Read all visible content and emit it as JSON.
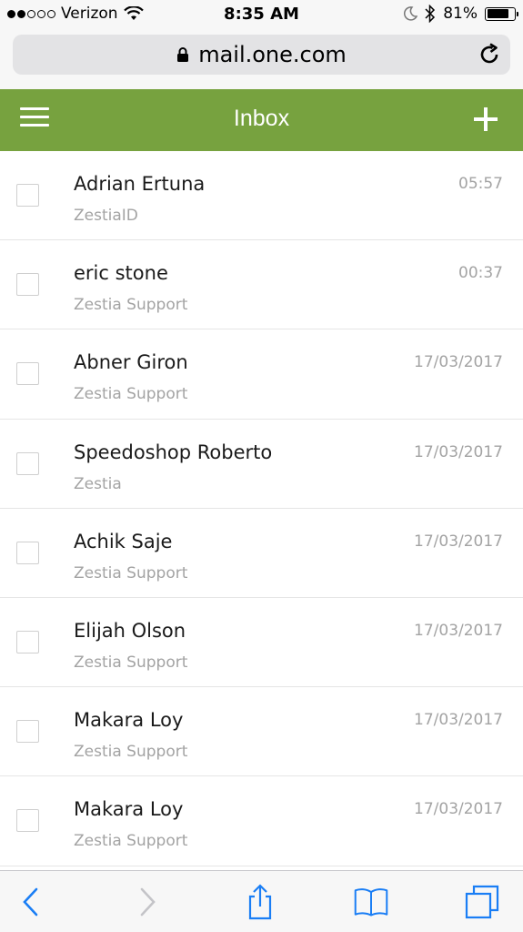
{
  "status_bar": {
    "carrier": "Verizon",
    "time": "8:35 AM",
    "battery_percent": "81%",
    "battery_level": 0.81,
    "signal_bars_filled": 2,
    "signal_bars_total": 5
  },
  "browser": {
    "url": "mail.one.com"
  },
  "header": {
    "title": "Inbox"
  },
  "emails": [
    {
      "sender": "Adrian Ertuna",
      "account": "ZestiaID",
      "time": "05:57"
    },
    {
      "sender": "eric stone",
      "account": "Zestia Support",
      "time": "00:37"
    },
    {
      "sender": "Abner Giron",
      "account": "Zestia Support",
      "time": "17/03/2017"
    },
    {
      "sender": "Speedoshop Roberto",
      "account": "Zestia",
      "time": "17/03/2017"
    },
    {
      "sender": "Achik Saje",
      "account": "Zestia Support",
      "time": "17/03/2017"
    },
    {
      "sender": "Elijah Olson",
      "account": "Zestia Support",
      "time": "17/03/2017"
    },
    {
      "sender": "Makara Loy",
      "account": "Zestia Support",
      "time": "17/03/2017"
    },
    {
      "sender": "Makara Loy",
      "account": "Zestia Support",
      "time": "17/03/2017"
    }
  ],
  "colors": {
    "header_green": "#77a23f",
    "ios_blue": "#1a7ef5"
  }
}
